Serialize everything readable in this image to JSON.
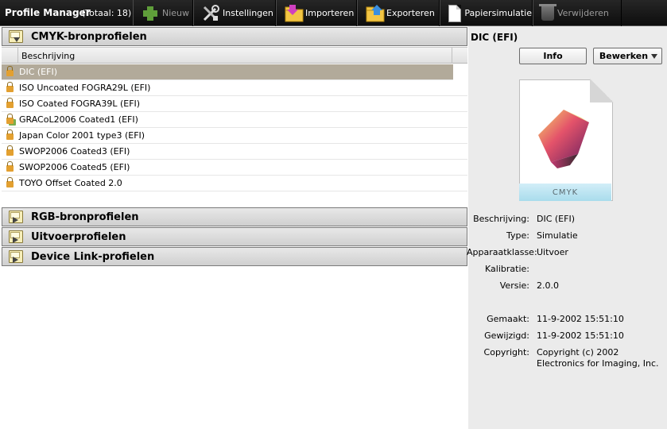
{
  "toolbar": {
    "title": "Profile Manager",
    "count": "(Totaal: 18)",
    "buttons": {
      "new": "Nieuw",
      "settings": "Instellingen",
      "import": "Importeren",
      "export": "Exporteren",
      "paper_sim": "Papiersimulatie",
      "delete": "Verwijderen"
    }
  },
  "sections": {
    "cmyk": "CMYK-bronprofielen",
    "rgb": "RGB-bronprofielen",
    "output": "Uitvoerprofielen",
    "devicelink": "Device Link-profielen"
  },
  "list": {
    "column_header": "Beschrijving",
    "rows": [
      "DIC (EFI)",
      "ISO Uncoated FOGRA29L (EFI)",
      "ISO Coated FOGRA39L (EFI)",
      "GRACoL2006 Coated1 (EFI)",
      "Japan Color 2001 type3 (EFI)",
      "SWOP2006 Coated3 (EFI)",
      "SWOP2006 Coated5 (EFI)",
      "TOYO Offset Coated 2.0"
    ]
  },
  "details": {
    "title": "DIC (EFI)",
    "info_button": "Info",
    "edit_button": "Bewerken",
    "thumb_label": "CMYK",
    "labels": {
      "description": "Beschrijving:",
      "type": "Type:",
      "device_class": "Apparaatklasse:",
      "calibration": "Kalibratie:",
      "version": "Versie:",
      "created": "Gemaakt:",
      "modified": "Gewijzigd:",
      "copyright": "Copyright:"
    },
    "values": {
      "description": "DIC (EFI)",
      "type": "Simulatie",
      "device_class": "Uitvoer",
      "calibration": "",
      "version": "2.0.0",
      "created": "11-9-2002 15:51:10",
      "modified": "11-9-2002 15:51:10",
      "copyright": "Copyright (c) 2002 Electronics for Imaging, Inc."
    }
  },
  "colors": {
    "toolbar_bg": "#1a1a1a",
    "selected_row": "#b2aa9a",
    "side_panel": "#ebebeb"
  },
  "icons": [
    "plus-icon",
    "tools-icon",
    "import-folder-icon",
    "export-folder-icon",
    "document-icon",
    "trash-icon",
    "folder-icon",
    "lock-icon"
  ]
}
